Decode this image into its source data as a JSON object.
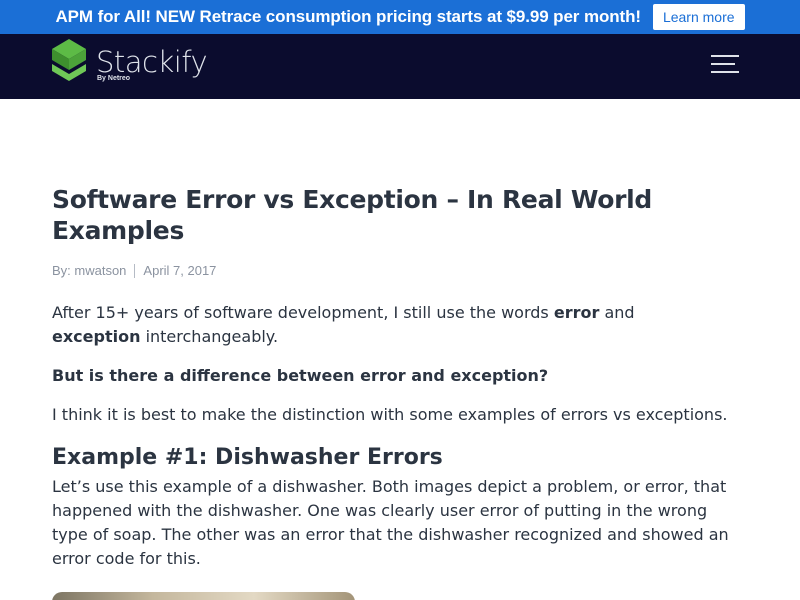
{
  "promo": {
    "text": "APM for All! NEW Retrace consumption pricing starts at $9.99 per month!",
    "button_label": "Learn more"
  },
  "header": {
    "logo_text": "Stackify",
    "logo_sub": "By Netreo",
    "menu_icon": "hamburger-menu-icon"
  },
  "article": {
    "title": "Software Error vs Exception – In Real World Examples",
    "author": "By: mwatson",
    "date": "April 7, 2017",
    "intro_before": "After 15+ years of software development, I still use the words ",
    "intro_bold1": "error",
    "intro_mid": " and ",
    "intro_bold2": "exception",
    "intro_after": " interchangeably.",
    "question": "But is there a difference between error and exception?",
    "thesis": "I think it is best to make the distinction with some examples of errors vs exceptions.",
    "section_heading": "Example #1: Dishwasher Errors",
    "section_text": "Let’s use this example of a dishwasher. Both images depict a problem, or error, that happened with the dishwasher. One was clearly user error of putting in the wrong type of soap. The other was an error that the dishwasher recognized and showed an error code for this."
  },
  "colors": {
    "promo_bg": "#1b6fd6",
    "header_bg": "#0b0c2e",
    "logo_green": "#5dbb46"
  }
}
